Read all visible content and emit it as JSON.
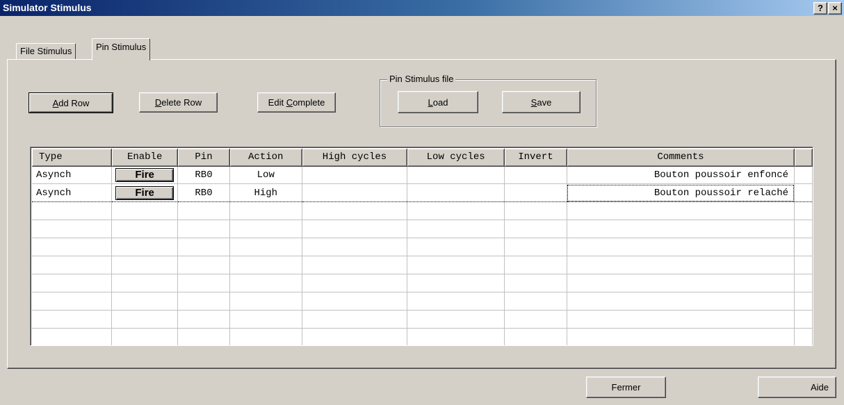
{
  "window": {
    "title": "Simulator Stimulus",
    "help_glyph": "?",
    "close_glyph": "×"
  },
  "tabs": [
    {
      "label": "File Stimulus",
      "active": false
    },
    {
      "label": "Pin Stimulus",
      "active": true
    }
  ],
  "toolbar": {
    "add_row": {
      "pre": "",
      "accel": "A",
      "post": "dd Row"
    },
    "delete_row": {
      "pre": "",
      "accel": "D",
      "post": "elete Row"
    },
    "edit_complete": {
      "pre": "Edit ",
      "accel": "C",
      "post": "omplete"
    }
  },
  "stimulus_file": {
    "group_label": "Pin Stimulus file",
    "load": {
      "pre": "",
      "accel": "L",
      "post": "oad"
    },
    "save": {
      "pre": "",
      "accel": "S",
      "post": "ave"
    }
  },
  "grid": {
    "columns": [
      "Type",
      "Enable",
      "Pin",
      "Action",
      "High cycles",
      "Low cycles",
      "Invert",
      "Comments"
    ],
    "rows": [
      {
        "type": "Asynch",
        "enable": "Fire",
        "pin": "RB0",
        "action": "Low",
        "high_cycles": "",
        "low_cycles": "",
        "invert": "",
        "comments": "Bouton poussoir enfoncé"
      },
      {
        "type": "Asynch",
        "enable": "Fire",
        "pin": "RB0",
        "action": "High",
        "high_cycles": "",
        "low_cycles": "",
        "invert": "",
        "comments": "Bouton poussoir relaché"
      }
    ],
    "empty_row_count": 8
  },
  "footer": {
    "close_label": "Fermer",
    "help_label": "Aide"
  },
  "colors": {
    "face": "#d4d0c8",
    "title_start": "#0a246a",
    "title_end": "#a6caf0"
  }
}
